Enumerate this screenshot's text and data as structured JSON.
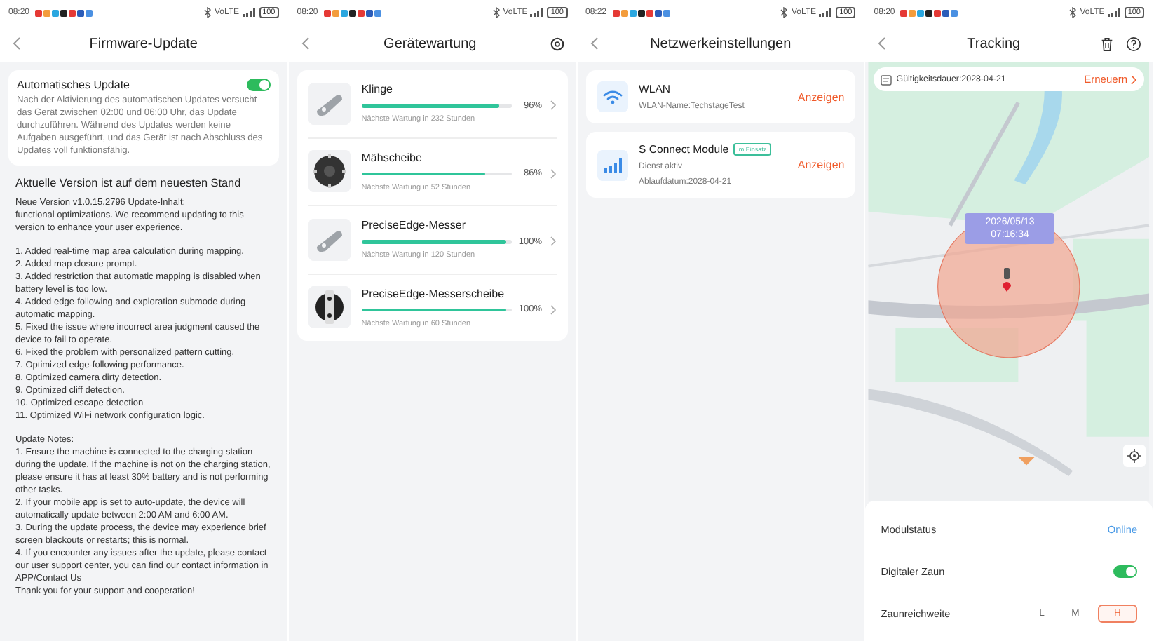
{
  "screens": [
    {
      "kind": "firmware",
      "status": {
        "time": "08:20",
        "network": "VoLTE",
        "battery": "100"
      },
      "title": "Firmware-Update",
      "auto_update": {
        "label": "Automatisches Update",
        "on": true,
        "description": "Nach der Aktivierung des automatischen Updates versucht das Gerät zwischen 02:00 und 06:00 Uhr, das Update durchzuführen. Während des Updates werden keine Aufgaben ausgeführt, und das Gerät ist nach Abschluss des Updates voll funktionsfähig."
      },
      "version_heading": "Aktuelle Version ist auf dem neuesten Stand",
      "note_blocks": [
        [
          "Neue Version v1.0.15.2796 Update-Inhalt:",
          "functional optimizations. We recommend updating to this version to enhance your user experience."
        ],
        [
          "1. Added real-time map area calculation during mapping.",
          "2. Added map closure prompt.",
          "3. Added restriction that automatic mapping is disabled when battery level is too low.",
          "4. Added edge-following and exploration submode during automatic mapping.",
          "5. Fixed the issue where incorrect area judgment caused the device to fail to operate.",
          "6. Fixed the problem with personalized pattern cutting.",
          "7. Optimized edge-following performance.",
          "8. Optimized camera dirty detection.",
          "9. Optimized cliff detection.",
          "10. Optimized escape detection",
          "11. Optimized WiFi network configuration logic."
        ],
        [
          "Update Notes:",
          "1. Ensure the machine is connected to the charging station during the update. If the machine is not on the charging station, please ensure it has at least 30% battery and is not performing other tasks.",
          "2. If your mobile app is set to auto-update, the device will automatically update between 2:00 AM and 6:00 AM.",
          "3. During the update process, the device may experience brief screen blackouts or restarts; this is normal.",
          "4. If you encounter any issues after the update, please contact our user support center, you can find our contact information in APP/Contact Us",
          "Thank you for your support and cooperation!"
        ]
      ]
    },
    {
      "kind": "maintenance",
      "status": {
        "time": "08:20",
        "network": "VoLTE",
        "battery": "100"
      },
      "title": "Gerätewartung",
      "parts": [
        {
          "kind": "blade",
          "name": "Klinge",
          "level": 0.96,
          "percent": "96%",
          "note": "Nächste Wartung in 232 Stunden"
        },
        {
          "kind": "disc",
          "name": "Mähscheibe",
          "level": 0.86,
          "percent": "86%",
          "note": "Nächste Wartung in 52 Stunden"
        },
        {
          "kind": "blade",
          "name": "PreciseEdge-Messer",
          "level": 1,
          "percent": "100%",
          "note": "Nächste Wartung in 120 Stunden"
        },
        {
          "kind": "edge-disc",
          "name": "PreciseEdge-Messerscheibe",
          "level": 1,
          "percent": "100%",
          "note": "Nächste Wartung in 60 Stunden"
        }
      ]
    },
    {
      "kind": "network",
      "status": {
        "time": "08:22",
        "network": "VoLTE",
        "battery": "100"
      },
      "title": "Netzwerkeinstellungen",
      "connections": [
        {
          "kind": "wifi",
          "name": "WLAN",
          "lines": [
            "WLAN-Name:TechstageTest"
          ],
          "action": "Anzeigen"
        },
        {
          "kind": "cellular",
          "name": "S Connect Module",
          "badge": "Im Einsatz",
          "lines": [
            "Dienst aktiv",
            "Ablaufdatum:2028-04-21"
          ],
          "action": "Anzeigen"
        }
      ]
    },
    {
      "kind": "tracking",
      "status": {
        "time": "08:20",
        "network": "VoLTE",
        "battery": "100"
      },
      "title": "Tracking",
      "validity": "Gültigkeitsdauer:2028-04-21",
      "renew": "Erneuern",
      "position": {
        "date": "2026/05/13",
        "time": "07:16:34"
      },
      "settings": [
        {
          "kind": "value",
          "label": "Modulstatus",
          "value": "Online"
        },
        {
          "kind": "toggle",
          "label": "Digitaler Zaun",
          "on": true
        },
        {
          "kind": "choice",
          "label": "Zaunreichweite",
          "options": [
            {
              "label": "L",
              "selected": false
            },
            {
              "label": "M",
              "selected": false
            },
            {
              "label": "H",
              "selected": true
            }
          ]
        }
      ]
    }
  ]
}
